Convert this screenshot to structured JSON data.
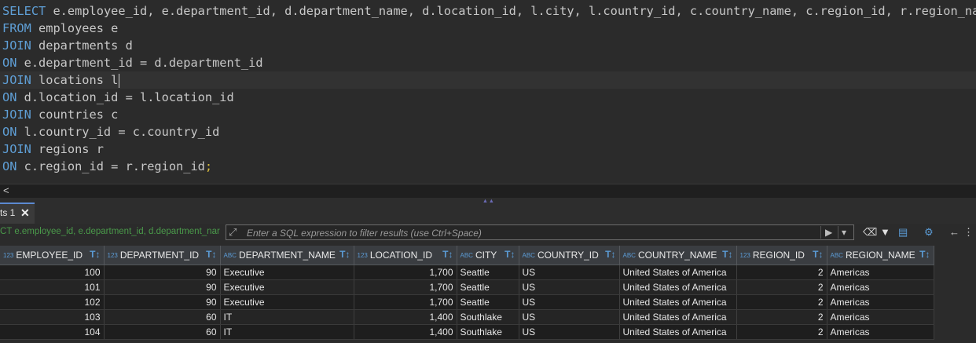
{
  "editor": {
    "lines": [
      [
        {
          "k": "kw",
          "t": "SELECT"
        },
        {
          "k": "txt",
          "t": " e.employee_id, e.department_id, d.department_name, d.location_id, l.city, l.country_id, c.country_name, c.region_id, r.region_name"
        }
      ],
      [
        {
          "k": "kw",
          "t": "FROM"
        },
        {
          "k": "txt",
          "t": " employees e"
        }
      ],
      [
        {
          "k": "kw",
          "t": "JOIN"
        },
        {
          "k": "txt",
          "t": " departments d"
        }
      ],
      [
        {
          "k": "kw",
          "t": "ON"
        },
        {
          "k": "txt",
          "t": " e.department_id = d.department_id"
        }
      ],
      [
        {
          "k": "kw",
          "t": "JOIN"
        },
        {
          "k": "txt",
          "t": " locations l"
        }
      ],
      [
        {
          "k": "kw",
          "t": "ON"
        },
        {
          "k": "txt",
          "t": " d.location_id = l.location_id"
        }
      ],
      [
        {
          "k": "kw",
          "t": "JOIN"
        },
        {
          "k": "txt",
          "t": " countries c"
        }
      ],
      [
        {
          "k": "kw",
          "t": "ON"
        },
        {
          "k": "txt",
          "t": " l.country_id = c.country_id"
        }
      ],
      [
        {
          "k": "kw",
          "t": "JOIN"
        },
        {
          "k": "txt",
          "t": " regions r"
        }
      ],
      [
        {
          "k": "kw",
          "t": "ON"
        },
        {
          "k": "txt",
          "t": " c.region_id = r.region_id"
        },
        {
          "k": "semi",
          "t": ";"
        }
      ]
    ],
    "current_line": 4
  },
  "results_tab": {
    "label": "ts 1",
    "close": "✕"
  },
  "filter": {
    "query_text": "CT e.employee_id, e.department_id, d.department_nar",
    "placeholder": "Enter a SQL expression to filter results (use Ctrl+Space)",
    "value": ""
  },
  "icons": {
    "expand": "expand-icon",
    "apply": "apply-filter-icon",
    "history": "filter-history-icon",
    "eraser": "eraser-icon",
    "funnel": "funnel-icon",
    "panel": "panel-icon",
    "settings": "settings-icon",
    "nav_left": "arrow-left-icon",
    "more": "more-icon"
  },
  "grid": {
    "columns": [
      {
        "name": "EMPLOYEE_ID",
        "type": "123",
        "align": "num"
      },
      {
        "name": "DEPARTMENT_ID",
        "type": "123",
        "align": "num"
      },
      {
        "name": "DEPARTMENT_NAME",
        "type": "ABC",
        "align": "text"
      },
      {
        "name": "LOCATION_ID",
        "type": "123",
        "align": "num"
      },
      {
        "name": "CITY",
        "type": "ABC",
        "align": "text"
      },
      {
        "name": "COUNTRY_ID",
        "type": "ABC",
        "align": "text"
      },
      {
        "name": "COUNTRY_NAME",
        "type": "ABC",
        "align": "text"
      },
      {
        "name": "REGION_ID",
        "type": "123",
        "align": "num"
      },
      {
        "name": "REGION_NAME",
        "type": "ABC",
        "align": "text"
      }
    ],
    "rows": [
      [
        "100",
        "90",
        "Executive",
        "1,700",
        "Seattle",
        "US",
        "United States of America",
        "2",
        "Americas"
      ],
      [
        "101",
        "90",
        "Executive",
        "1,700",
        "Seattle",
        "US",
        "United States of America",
        "2",
        "Americas"
      ],
      [
        "102",
        "90",
        "Executive",
        "1,700",
        "Seattle",
        "US",
        "United States of America",
        "2",
        "Americas"
      ],
      [
        "103",
        "60",
        "IT",
        "1,400",
        "Southlake",
        "US",
        "United States of America",
        "2",
        "Americas"
      ],
      [
        "104",
        "60",
        "IT",
        "1,400",
        "Southlake",
        "US",
        "United States of America",
        "2",
        "Americas"
      ]
    ]
  }
}
